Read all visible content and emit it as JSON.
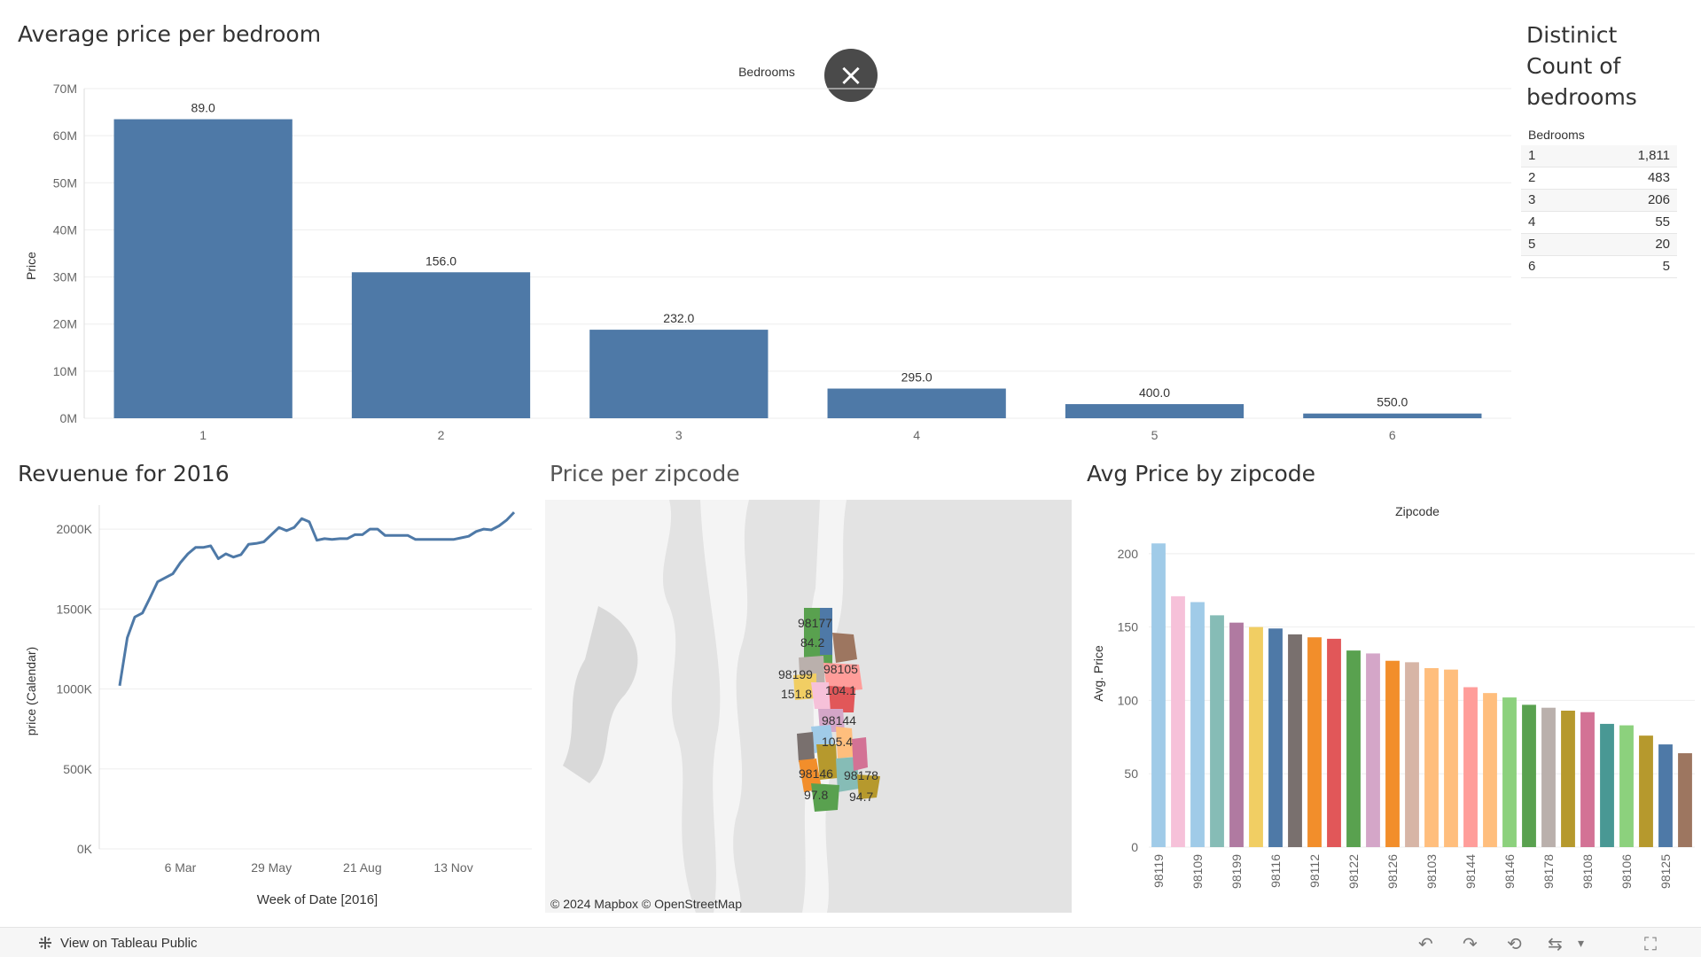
{
  "panels": {
    "bedroom_title": "Average price per bedroom",
    "revenue_title": "Revuenue for 2016",
    "map_title": "Price per zipcode",
    "zip_title": "Avg Price by zipcode",
    "count_title": "Distinict Count of bedrooms"
  },
  "close_icon": "×",
  "count_table": {
    "header": "Bedrooms",
    "rows": [
      {
        "bedrooms": "1",
        "count": "1,811"
      },
      {
        "bedrooms": "2",
        "count": "483"
      },
      {
        "bedrooms": "3",
        "count": "206"
      },
      {
        "bedrooms": "4",
        "count": "55"
      },
      {
        "bedrooms": "5",
        "count": "20"
      },
      {
        "bedrooms": "6",
        "count": "5"
      }
    ]
  },
  "map": {
    "attribution": "© 2024 Mapbox  © OpenStreetMap",
    "labels": [
      "98177",
      "84.2",
      "98199",
      "151.8",
      "98105",
      "104.1",
      "98144",
      "105.4",
      "98146",
      "97.8",
      "98178",
      "94.7"
    ]
  },
  "footer": {
    "view_label": "View on Tableau Public",
    "icons": [
      "tableau-logo-icon",
      "undo-icon",
      "redo-icon",
      "revert-icon",
      "share-icon",
      "dropdown-icon",
      "fullscreen-icon"
    ]
  },
  "colors": {
    "bar_blue": "#4e79a7",
    "line_blue": "#4e79a7",
    "zip_palette": [
      "#a0cbe8",
      "#f6c1d9",
      "#a0cbe8",
      "#86bcb6",
      "#b07aa1",
      "#f1ce63",
      "#4e79a7",
      "#79706e",
      "#f28e2b",
      "#e15759",
      "#59a14f",
      "#d4a6c8",
      "#f28e2b",
      "#d7b5a6",
      "#ffbe7d",
      "#ffbe7d",
      "#ff9d9a",
      "#ffbe7d",
      "#8cd17d",
      "#59a14f",
      "#bab0ac",
      "#b6992d",
      "#d37295",
      "#499894",
      "#8cd17d",
      "#b6992d",
      "#4e79a7",
      "#9d7660"
    ]
  },
  "chart_data": [
    {
      "type": "bar",
      "title": "Average price per bedroom",
      "top_label": "Bedrooms",
      "xlabel": "",
      "ylabel": "Price",
      "categories": [
        "1",
        "2",
        "3",
        "4",
        "5",
        "6"
      ],
      "values": [
        63500000,
        31000000,
        18800000,
        6300000,
        3000000,
        1000000
      ],
      "data_labels": [
        "89.0",
        "156.0",
        "232.0",
        "295.0",
        "400.0",
        "550.0"
      ],
      "yticks": [
        0,
        10000000,
        20000000,
        30000000,
        40000000,
        50000000,
        60000000,
        70000000
      ],
      "ytick_labels": [
        "0M",
        "10M",
        "20M",
        "30M",
        "40M",
        "50M",
        "60M",
        "70M"
      ],
      "ylim": [
        0,
        70000000
      ]
    },
    {
      "type": "line",
      "title": "Revuenue for 2016",
      "xlabel": "Week of Date [2016]",
      "ylabel": "price (Calendar)",
      "x_ticks": [
        {
          "label": "6 Mar",
          "week": 9
        },
        {
          "label": "29 May",
          "week": 21
        },
        {
          "label": "21 Aug",
          "week": 33
        },
        {
          "label": "13 Nov",
          "week": 45
        }
      ],
      "x": [
        1,
        2,
        3,
        4,
        5,
        6,
        7,
        8,
        9,
        10,
        11,
        12,
        13,
        14,
        15,
        16,
        17,
        18,
        19,
        20,
        21,
        22,
        23,
        24,
        25,
        26,
        27,
        28,
        29,
        30,
        31,
        32,
        33,
        34,
        35,
        36,
        37,
        38,
        39,
        40,
        41,
        42,
        43,
        44,
        45,
        46,
        47,
        48,
        49,
        50,
        51,
        52,
        53
      ],
      "values": [
        1020000,
        1320000,
        1450000,
        1475000,
        1570000,
        1670000,
        1695000,
        1720000,
        1790000,
        1845000,
        1885000,
        1885000,
        1895000,
        1815000,
        1845000,
        1825000,
        1840000,
        1905000,
        1910000,
        1920000,
        1965000,
        2010000,
        1990000,
        2010000,
        2065000,
        2045000,
        1930000,
        1940000,
        1935000,
        1940000,
        1940000,
        1965000,
        1965000,
        2000000,
        2000000,
        1960000,
        1960000,
        1960000,
        1960000,
        1935000,
        1935000,
        1935000,
        1935000,
        1935000,
        1935000,
        1945000,
        1955000,
        1985000,
        2000000,
        1995000,
        2020000,
        2055000,
        2105000
      ],
      "yticks": [
        0,
        500000,
        1000000,
        1500000,
        2000000
      ],
      "ytick_labels": [
        "0K",
        "500K",
        "1000K",
        "1500K",
        "2000K"
      ],
      "ylim": [
        0,
        2150000
      ]
    },
    {
      "type": "bar",
      "title": "Avg Price by zipcode",
      "top_label": "Zipcode",
      "xlabel": "",
      "ylabel": "Avg. Price",
      "categories": [
        "98119",
        "",
        "98109",
        "",
        "98199",
        "",
        "98116",
        "",
        "98112",
        "",
        "98122",
        "",
        "98126",
        "",
        "98103",
        "",
        "98144",
        "",
        "98146",
        "",
        "98178",
        "",
        "98108",
        "",
        "98106",
        "",
        "98125",
        ""
      ],
      "values": [
        207,
        171,
        167,
        158,
        153,
        150,
        149,
        145,
        143,
        142,
        134,
        132,
        127,
        126,
        122,
        121,
        109,
        105,
        102,
        97,
        95,
        93,
        92,
        84,
        83,
        76,
        70,
        64
      ],
      "yticks": [
        0,
        50,
        100,
        150,
        200
      ],
      "ylim": [
        0,
        215
      ]
    }
  ]
}
